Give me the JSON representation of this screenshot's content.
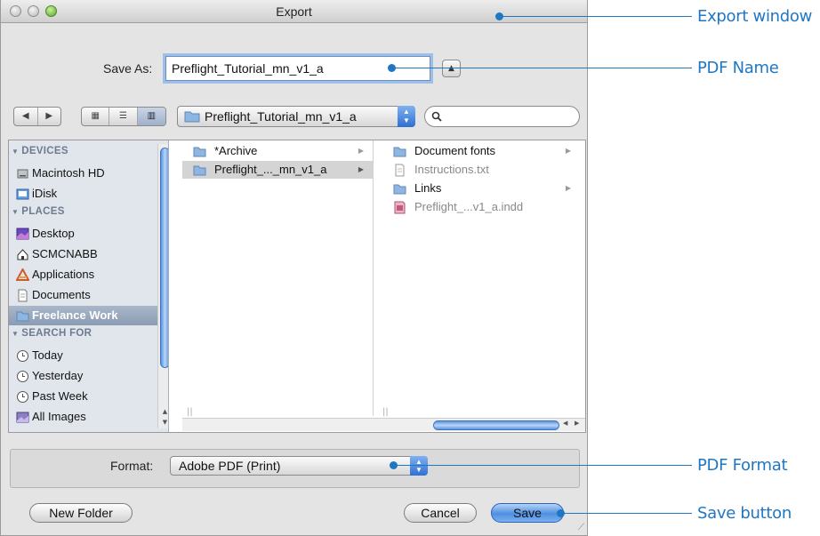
{
  "window": {
    "title": "Export"
  },
  "save_as": {
    "label": "Save As:",
    "value": "Preflight_Tutorial_mn_v1_a"
  },
  "toolbar": {
    "back_glyph": "◀",
    "forward_glyph": "▶",
    "view_icons": "▦",
    "view_list": "☰",
    "view_columns": "▥",
    "path_popup": "Preflight_Tutorial_mn_v1_a",
    "search_placeholder": "",
    "search_glyph": "🔍"
  },
  "sidebar": {
    "sections": [
      {
        "title": "DEVICES",
        "items": [
          {
            "label": "Macintosh HD",
            "icon": "hard-drive-icon"
          },
          {
            "label": "iDisk",
            "icon": "idisk-icon"
          }
        ]
      },
      {
        "title": "PLACES",
        "items": [
          {
            "label": "Desktop",
            "icon": "desktop-icon"
          },
          {
            "label": "SCMCNABB",
            "icon": "home-icon"
          },
          {
            "label": "Applications",
            "icon": "applications-icon"
          },
          {
            "label": "Documents",
            "icon": "documents-icon"
          },
          {
            "label": "Freelance Work",
            "icon": "folder-icon",
            "selected": true
          }
        ]
      },
      {
        "title": "SEARCH FOR",
        "items": [
          {
            "label": "Today",
            "icon": "clock-icon"
          },
          {
            "label": "Yesterday",
            "icon": "clock-icon"
          },
          {
            "label": "Past Week",
            "icon": "clock-icon"
          },
          {
            "label": "All Images",
            "icon": "images-icon"
          }
        ]
      }
    ]
  },
  "columns": [
    {
      "rows": [
        {
          "label": "*Archive",
          "icon": "folder-icon",
          "arrow": true
        },
        {
          "label": "Preflight_..._mn_v1_a",
          "icon": "folder-icon",
          "arrow": true,
          "selected": true
        }
      ]
    },
    {
      "rows": [
        {
          "label": "Document fonts",
          "icon": "folder-icon",
          "arrow": true
        },
        {
          "label": "Instructions.txt",
          "icon": "text-file-icon",
          "dimmed": true
        },
        {
          "label": "Links",
          "icon": "folder-icon",
          "arrow": true
        },
        {
          "label": "Preflight_...v1_a.indd",
          "icon": "indesign-file-icon",
          "dimmed": true
        }
      ]
    }
  ],
  "format": {
    "label": "Format:",
    "value": "Adobe PDF (Print)"
  },
  "buttons": {
    "new_folder": "New Folder",
    "cancel": "Cancel",
    "save": "Save"
  },
  "callouts": {
    "export_window": "Export window",
    "pdf_name": "PDF Name",
    "pdf_format": "PDF Format",
    "save_button": "Save button"
  },
  "colors": {
    "callout": "#1f77c4",
    "selection": "#8b9bb2",
    "default_button": "#4f8fe0"
  }
}
